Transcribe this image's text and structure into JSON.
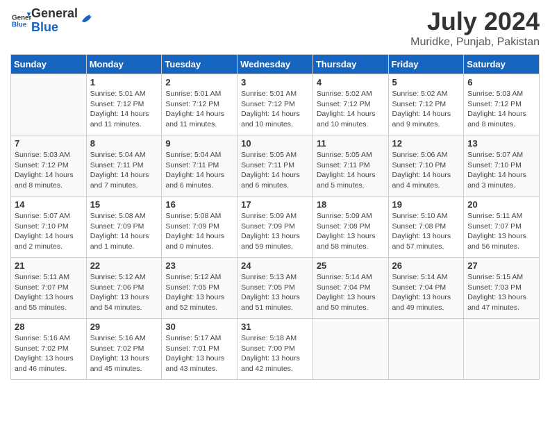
{
  "header": {
    "logo_general": "General",
    "logo_blue": "Blue",
    "month_year": "July 2024",
    "location": "Muridke, Punjab, Pakistan"
  },
  "days_of_week": [
    "Sunday",
    "Monday",
    "Tuesday",
    "Wednesday",
    "Thursday",
    "Friday",
    "Saturday"
  ],
  "weeks": [
    [
      {
        "day": "",
        "sunrise": "",
        "sunset": "",
        "daylight": ""
      },
      {
        "day": "1",
        "sunrise": "Sunrise: 5:01 AM",
        "sunset": "Sunset: 7:12 PM",
        "daylight": "Daylight: 14 hours and 11 minutes."
      },
      {
        "day": "2",
        "sunrise": "Sunrise: 5:01 AM",
        "sunset": "Sunset: 7:12 PM",
        "daylight": "Daylight: 14 hours and 11 minutes."
      },
      {
        "day": "3",
        "sunrise": "Sunrise: 5:01 AM",
        "sunset": "Sunset: 7:12 PM",
        "daylight": "Daylight: 14 hours and 10 minutes."
      },
      {
        "day": "4",
        "sunrise": "Sunrise: 5:02 AM",
        "sunset": "Sunset: 7:12 PM",
        "daylight": "Daylight: 14 hours and 10 minutes."
      },
      {
        "day": "5",
        "sunrise": "Sunrise: 5:02 AM",
        "sunset": "Sunset: 7:12 PM",
        "daylight": "Daylight: 14 hours and 9 minutes."
      },
      {
        "day": "6",
        "sunrise": "Sunrise: 5:03 AM",
        "sunset": "Sunset: 7:12 PM",
        "daylight": "Daylight: 14 hours and 8 minutes."
      }
    ],
    [
      {
        "day": "7",
        "sunrise": "Sunrise: 5:03 AM",
        "sunset": "Sunset: 7:12 PM",
        "daylight": "Daylight: 14 hours and 8 minutes."
      },
      {
        "day": "8",
        "sunrise": "Sunrise: 5:04 AM",
        "sunset": "Sunset: 7:11 PM",
        "daylight": "Daylight: 14 hours and 7 minutes."
      },
      {
        "day": "9",
        "sunrise": "Sunrise: 5:04 AM",
        "sunset": "Sunset: 7:11 PM",
        "daylight": "Daylight: 14 hours and 6 minutes."
      },
      {
        "day": "10",
        "sunrise": "Sunrise: 5:05 AM",
        "sunset": "Sunset: 7:11 PM",
        "daylight": "Daylight: 14 hours and 6 minutes."
      },
      {
        "day": "11",
        "sunrise": "Sunrise: 5:05 AM",
        "sunset": "Sunset: 7:11 PM",
        "daylight": "Daylight: 14 hours and 5 minutes."
      },
      {
        "day": "12",
        "sunrise": "Sunrise: 5:06 AM",
        "sunset": "Sunset: 7:10 PM",
        "daylight": "Daylight: 14 hours and 4 minutes."
      },
      {
        "day": "13",
        "sunrise": "Sunrise: 5:07 AM",
        "sunset": "Sunset: 7:10 PM",
        "daylight": "Daylight: 14 hours and 3 minutes."
      }
    ],
    [
      {
        "day": "14",
        "sunrise": "Sunrise: 5:07 AM",
        "sunset": "Sunset: 7:10 PM",
        "daylight": "Daylight: 14 hours and 2 minutes."
      },
      {
        "day": "15",
        "sunrise": "Sunrise: 5:08 AM",
        "sunset": "Sunset: 7:09 PM",
        "daylight": "Daylight: 14 hours and 1 minute."
      },
      {
        "day": "16",
        "sunrise": "Sunrise: 5:08 AM",
        "sunset": "Sunset: 7:09 PM",
        "daylight": "Daylight: 14 hours and 0 minutes."
      },
      {
        "day": "17",
        "sunrise": "Sunrise: 5:09 AM",
        "sunset": "Sunset: 7:09 PM",
        "daylight": "Daylight: 13 hours and 59 minutes."
      },
      {
        "day": "18",
        "sunrise": "Sunrise: 5:09 AM",
        "sunset": "Sunset: 7:08 PM",
        "daylight": "Daylight: 13 hours and 58 minutes."
      },
      {
        "day": "19",
        "sunrise": "Sunrise: 5:10 AM",
        "sunset": "Sunset: 7:08 PM",
        "daylight": "Daylight: 13 hours and 57 minutes."
      },
      {
        "day": "20",
        "sunrise": "Sunrise: 5:11 AM",
        "sunset": "Sunset: 7:07 PM",
        "daylight": "Daylight: 13 hours and 56 minutes."
      }
    ],
    [
      {
        "day": "21",
        "sunrise": "Sunrise: 5:11 AM",
        "sunset": "Sunset: 7:07 PM",
        "daylight": "Daylight: 13 hours and 55 minutes."
      },
      {
        "day": "22",
        "sunrise": "Sunrise: 5:12 AM",
        "sunset": "Sunset: 7:06 PM",
        "daylight": "Daylight: 13 hours and 54 minutes."
      },
      {
        "day": "23",
        "sunrise": "Sunrise: 5:12 AM",
        "sunset": "Sunset: 7:05 PM",
        "daylight": "Daylight: 13 hours and 52 minutes."
      },
      {
        "day": "24",
        "sunrise": "Sunrise: 5:13 AM",
        "sunset": "Sunset: 7:05 PM",
        "daylight": "Daylight: 13 hours and 51 minutes."
      },
      {
        "day": "25",
        "sunrise": "Sunrise: 5:14 AM",
        "sunset": "Sunset: 7:04 PM",
        "daylight": "Daylight: 13 hours and 50 minutes."
      },
      {
        "day": "26",
        "sunrise": "Sunrise: 5:14 AM",
        "sunset": "Sunset: 7:04 PM",
        "daylight": "Daylight: 13 hours and 49 minutes."
      },
      {
        "day": "27",
        "sunrise": "Sunrise: 5:15 AM",
        "sunset": "Sunset: 7:03 PM",
        "daylight": "Daylight: 13 hours and 47 minutes."
      }
    ],
    [
      {
        "day": "28",
        "sunrise": "Sunrise: 5:16 AM",
        "sunset": "Sunset: 7:02 PM",
        "daylight": "Daylight: 13 hours and 46 minutes."
      },
      {
        "day": "29",
        "sunrise": "Sunrise: 5:16 AM",
        "sunset": "Sunset: 7:02 PM",
        "daylight": "Daylight: 13 hours and 45 minutes."
      },
      {
        "day": "30",
        "sunrise": "Sunrise: 5:17 AM",
        "sunset": "Sunset: 7:01 PM",
        "daylight": "Daylight: 13 hours and 43 minutes."
      },
      {
        "day": "31",
        "sunrise": "Sunrise: 5:18 AM",
        "sunset": "Sunset: 7:00 PM",
        "daylight": "Daylight: 13 hours and 42 minutes."
      },
      {
        "day": "",
        "sunrise": "",
        "sunset": "",
        "daylight": ""
      },
      {
        "day": "",
        "sunrise": "",
        "sunset": "",
        "daylight": ""
      },
      {
        "day": "",
        "sunrise": "",
        "sunset": "",
        "daylight": ""
      }
    ]
  ]
}
